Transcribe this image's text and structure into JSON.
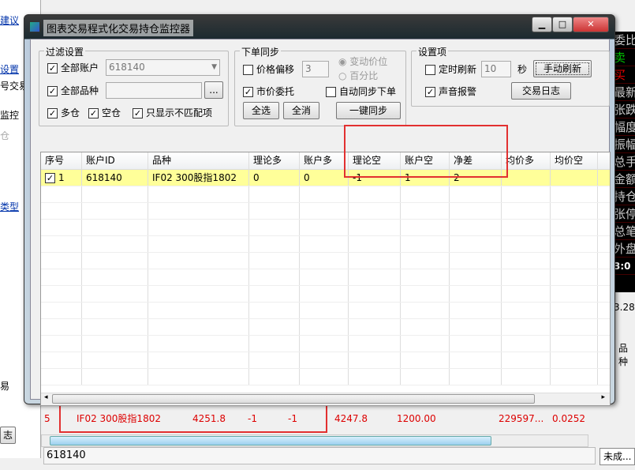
{
  "background": {
    "left_items": [
      "建议",
      "设置",
      "号交易",
      "监控",
      "仓",
      "类型",
      "易",
      "志"
    ],
    "right_panel": [
      "委比",
      "卖",
      "买",
      "最新",
      "张跌",
      "幅度",
      "振幅",
      "总手",
      "金额",
      "持仓",
      "张停",
      "总笔",
      "外盘"
    ],
    "right_time": "3:0",
    "right_value": "3.28",
    "right_header": "品种",
    "bottom_row": {
      "index": "5",
      "symbol": "IF02 300股指1802",
      "price": "4251.8",
      "col3": "-1",
      "col4": "-1",
      "col5": "4247.8",
      "col6": "1200.00",
      "col7": "229597...",
      "col8": "0.0252"
    },
    "status_account": "618140",
    "tab_unfilled": "未成..."
  },
  "dialog": {
    "title": "图表交易程式化交易持仓监控器",
    "filter": {
      "title": "过滤设置",
      "all_accounts": "全部账户",
      "account_value": "618140",
      "all_symbols": "全部品种",
      "symbol_value": "",
      "browse": "...",
      "long": "多仓",
      "short": "空仓",
      "only_mismatch": "只显示不匹配项"
    },
    "sync": {
      "title": "下单同步",
      "price_offset": "价格偏移",
      "offset_value": "3",
      "radio_tick": "变动价位",
      "radio_percent": "百分比",
      "market_order": "市价委托",
      "auto_sync": "自动同步下单",
      "select_all": "全选",
      "deselect_all": "全消",
      "one_click_sync": "一键同步"
    },
    "settings": {
      "title": "设置项",
      "timed_refresh": "定时刷新",
      "interval_value": "10",
      "seconds": "秒",
      "manual_refresh": "手动刷新",
      "sound_alert": "声音报警",
      "trade_log": "交易日志"
    },
    "table": {
      "headers": [
        "序号",
        "账户ID",
        "品种",
        "理论多",
        "账户多",
        "理论空",
        "账户空",
        "净差",
        "均价多",
        "均价空"
      ],
      "rows": [
        [
          "1",
          "618140",
          "IF02 300股指1802",
          "0",
          "0",
          "-1",
          "1",
          "2",
          "",
          ""
        ]
      ]
    }
  }
}
